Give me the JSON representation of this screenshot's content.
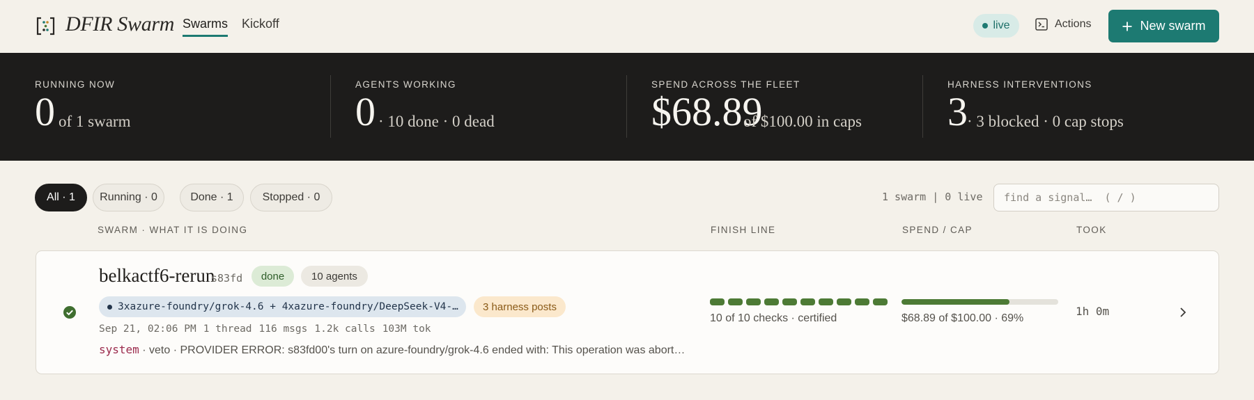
{
  "header": {
    "brand": "DFIR Swarm",
    "tabs": [
      {
        "label": "Swarms",
        "active": true
      },
      {
        "label": "Kickoff",
        "active": false
      }
    ],
    "live_label": "live",
    "actions_label": "Actions",
    "new_swarm_label": "New swarm"
  },
  "stats": [
    {
      "label": "RUNNING NOW",
      "value": "0",
      "detail": "of 1 swarm"
    },
    {
      "label": "AGENTS WORKING",
      "value": "0",
      "detail": "· 10 done · 0 dead"
    },
    {
      "label": "SPEND ACROSS THE FLEET",
      "value": "$68.89",
      "detail": "of $100.00 in caps"
    },
    {
      "label": "HARNESS INTERVENTIONS",
      "value": "3",
      "detail": "· 3 blocked · 0 cap stops"
    }
  ],
  "filters": [
    {
      "label": "All · 1",
      "active": true
    },
    {
      "label": "Running · 0",
      "active": false
    },
    {
      "label": "Done · 1",
      "active": false
    },
    {
      "label": "Stopped · 0",
      "active": false
    }
  ],
  "summary": "1 swarm | 0 live",
  "search_placeholder": "find a signal…  ( / )",
  "columns": {
    "swarm": "SWARM · WHAT IT IS DOING",
    "finish": "FINISH LINE",
    "spend": "SPEND / CAP",
    "took": "TOOK"
  },
  "swarm": {
    "name": "belkactf6-rerun",
    "id": "s83fd",
    "status": "done",
    "agents": "10 agents",
    "models": "3xazure-foundry/grok-4.6 + 4xazure-foundry/DeepSeek-V4-…",
    "harness": "3 harness posts",
    "meta": [
      "Sep 21, 02:06 PM",
      "1 thread",
      "116 msgs",
      "1.2k calls",
      "103M tok"
    ],
    "event_source": "system",
    "event_text": " · veto · PROVIDER ERROR: s83fd00's turn on azure-foundry/grok-4.6 ended with: This operation was abort…",
    "checks_total": 10,
    "checks_done": 10,
    "checks_text": "10 of 10 checks · certified",
    "spend_fraction": 0.69,
    "spend_text": "$68.89 of $100.00 · 69%",
    "took": "1h 0m"
  },
  "colors": {
    "accent": "#1d7a72",
    "stats_bg": "#1d1c1b",
    "success": "#4d7a35",
    "page_bg": "#f4f1ea"
  },
  "icons": [
    "logo-bracket-icon",
    "terminal-icon",
    "plus-icon",
    "check-circle-icon",
    "chevron-right-icon"
  ]
}
